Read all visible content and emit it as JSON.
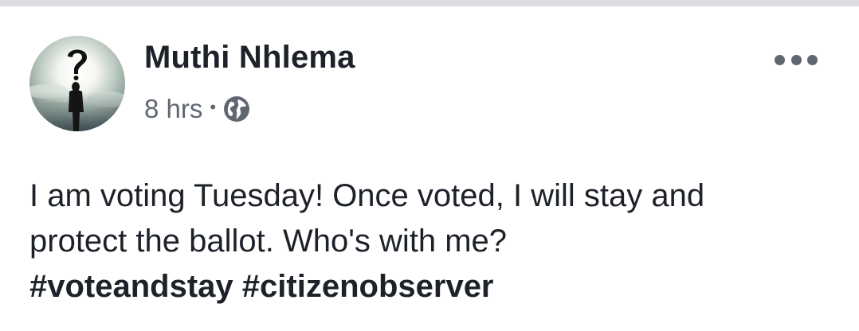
{
  "post": {
    "author": "Muthi Nhlema",
    "timestamp": "8 hrs",
    "separator": "•",
    "privacy_icon": "globe-icon",
    "more_icon": "more-options-icon",
    "text_lines": [
      "I am voting Tuesday! Once voted, I will stay and",
      "protect the ballot. Who's with me?"
    ],
    "hashtags": [
      "#voteandstay",
      "#citizenobserver"
    ]
  },
  "colors": {
    "text_primary": "#1d2129",
    "text_secondary": "#606770",
    "divider": "#dcdee3"
  }
}
